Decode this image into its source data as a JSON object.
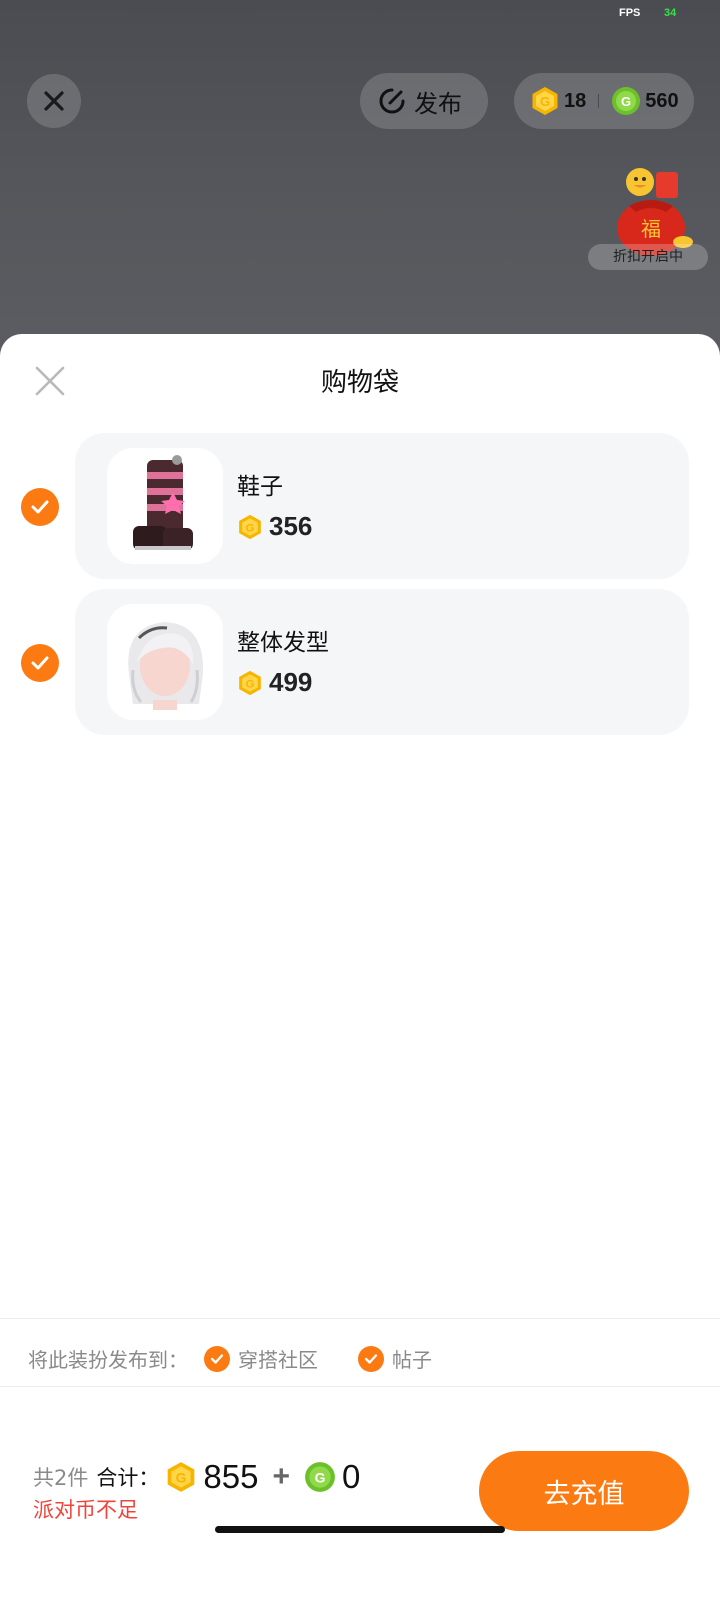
{
  "status": {
    "fps_label": "FPS",
    "fps_value": "34"
  },
  "topbar": {
    "publish_label": "发布",
    "gold_coins": "18",
    "green_coins": "560"
  },
  "promo": {
    "label": "折扣开启中"
  },
  "sheet": {
    "title": "购物袋",
    "items": [
      {
        "name": "鞋子",
        "price": "356",
        "checked": true
      },
      {
        "name": "整体发型",
        "price": "499",
        "checked": true
      }
    ]
  },
  "publish_to": {
    "label": "将此装扮发布到：",
    "options": [
      {
        "label": "穿搭社区",
        "checked": true
      },
      {
        "label": "帖子",
        "checked": true
      }
    ]
  },
  "footer": {
    "count_text": "共2件",
    "total_label": "合计：",
    "gold_total": "855",
    "plus": "+",
    "green_total": "0",
    "warning": "派对币不足",
    "recharge_label": "去充值"
  },
  "colors": {
    "accent": "#fb7a12",
    "warning": "#f0443b",
    "gold": "#f7b500",
    "green": "#6cc12a"
  }
}
